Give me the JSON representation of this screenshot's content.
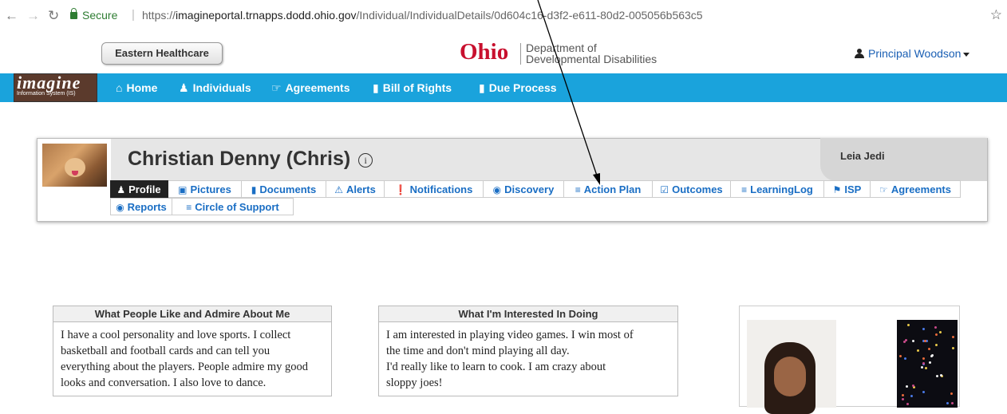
{
  "browser": {
    "secure_label": "Secure",
    "url_scheme": "https://",
    "url_domain": "imagineportal.trnapps.dodd.ohio.gov",
    "url_path": "/Individual/IndividualDetails/0d604c16-d3f2-e611-80d2-005056b563c5",
    "icons": [
      "back-arrow-icon",
      "forward-arrow-icon",
      "reload-icon",
      "lock-icon",
      "star-icon"
    ]
  },
  "header": {
    "facility_button": "Eastern Healthcare",
    "ohio_logo": "Ohio",
    "department_line1": "Department of",
    "department_line2": "Developmental Disabilities",
    "user_name": "Principal Woodson"
  },
  "logo": {
    "word": "imagine",
    "subtitle": "Information System (IS)"
  },
  "nav": {
    "items": [
      {
        "label": "Home",
        "icon": "home-icon"
      },
      {
        "label": "Individuals",
        "icon": "user-icon"
      },
      {
        "label": "Agreements",
        "icon": "thumbs-up-icon"
      },
      {
        "label": "Bill of Rights",
        "icon": "file-icon"
      },
      {
        "label": "Due Process",
        "icon": "file-icon"
      }
    ]
  },
  "profile": {
    "name": "Christian Denny (Chris)",
    "staff_name": "Leia Jedi",
    "tabs": [
      {
        "label": "Profile",
        "icon": "user-icon",
        "active": true
      },
      {
        "label": "Pictures",
        "icon": "picture-icon"
      },
      {
        "label": "Documents",
        "icon": "file-icon"
      },
      {
        "label": "Alerts",
        "icon": "warning-icon"
      },
      {
        "label": "Notifications",
        "icon": "exclamation-circle-icon"
      },
      {
        "label": "Discovery",
        "icon": "eye-icon"
      },
      {
        "label": "Action Plan",
        "icon": "list-icon"
      },
      {
        "label": "Outcomes",
        "icon": "check-square-icon"
      },
      {
        "label": "LearningLog",
        "icon": "list-icon"
      },
      {
        "label": "ISP",
        "icon": "flag-icon"
      },
      {
        "label": "Agreements",
        "icon": "thumbs-up-icon"
      },
      {
        "label": "Reports",
        "icon": "eye-icon"
      },
      {
        "label": "Circle of Support",
        "icon": "list-icon"
      }
    ]
  },
  "sections": {
    "like": {
      "title": "What People Like and Admire About Me",
      "lines": [
        "I have a cool personality and love sports. I collect",
        "basketball and football cards and can tell you",
        "everything about the players. People admire my good",
        "looks and conversation. I also love to dance."
      ]
    },
    "interest": {
      "title": "What I'm Interested In Doing",
      "lines": [
        "I am interested in playing video games. I win most of",
        "the time and don't mind playing all day.",
        "I'd really like to learn to cook. I am crazy about",
        "sloppy joes!"
      ]
    }
  },
  "colors": {
    "nav_blue": "#1aa3dc",
    "link_blue": "#1a6ec4",
    "ohio_red": "#c8102e",
    "secure_green": "#2e7d32"
  }
}
